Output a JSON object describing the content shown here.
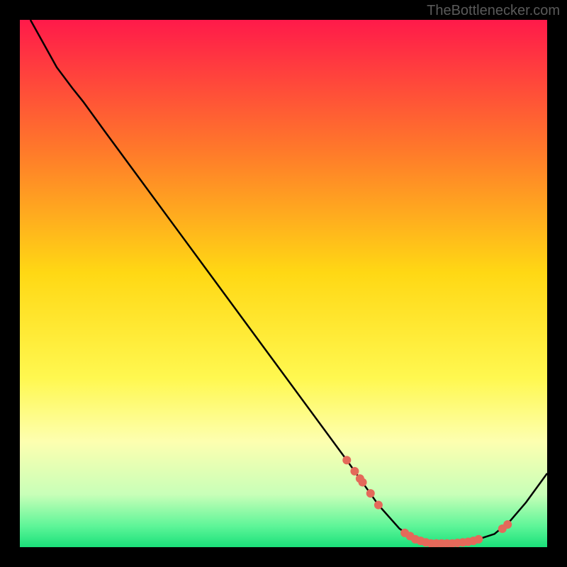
{
  "watermark": "TheBottlenecker.com",
  "chart_data": {
    "type": "line",
    "title": "",
    "xlabel": "",
    "ylabel": "",
    "xlim": [
      0,
      100
    ],
    "ylim": [
      0,
      100
    ],
    "background_gradient": {
      "stops": [
        {
          "offset": 0,
          "color": "#ff1a4a"
        },
        {
          "offset": 25,
          "color": "#ff7a2a"
        },
        {
          "offset": 48,
          "color": "#ffd814"
        },
        {
          "offset": 68,
          "color": "#fff850"
        },
        {
          "offset": 80,
          "color": "#fdffb0"
        },
        {
          "offset": 90,
          "color": "#c8ffb8"
        },
        {
          "offset": 96,
          "color": "#5ef598"
        },
        {
          "offset": 100,
          "color": "#1ae07a"
        }
      ]
    },
    "series": [
      {
        "name": "curve",
        "color": "#000000",
        "points": [
          {
            "x": 2,
            "y": 100
          },
          {
            "x": 7,
            "y": 91
          },
          {
            "x": 10,
            "y": 87
          },
          {
            "x": 12,
            "y": 84.5
          },
          {
            "x": 16,
            "y": 79
          },
          {
            "x": 62,
            "y": 16.5
          },
          {
            "x": 68,
            "y": 8
          },
          {
            "x": 72,
            "y": 3.5
          },
          {
            "x": 75,
            "y": 1.5
          },
          {
            "x": 78,
            "y": 0.7
          },
          {
            "x": 82,
            "y": 0.7
          },
          {
            "x": 86,
            "y": 1.2
          },
          {
            "x": 90,
            "y": 2.5
          },
          {
            "x": 93,
            "y": 5
          },
          {
            "x": 96,
            "y": 8.5
          },
          {
            "x": 100,
            "y": 14
          }
        ]
      }
    ],
    "markers": {
      "color": "#e4695a",
      "radius": 6,
      "points": [
        {
          "x": 62,
          "y": 16.5
        },
        {
          "x": 63.5,
          "y": 14.4
        },
        {
          "x": 64.5,
          "y": 13.0
        },
        {
          "x": 65,
          "y": 12.3
        },
        {
          "x": 66.5,
          "y": 10.2
        },
        {
          "x": 68,
          "y": 8
        },
        {
          "x": 73,
          "y": 2.7
        },
        {
          "x": 74,
          "y": 2.1
        },
        {
          "x": 75,
          "y": 1.5
        },
        {
          "x": 76,
          "y": 1.2
        },
        {
          "x": 77,
          "y": 0.9
        },
        {
          "x": 78,
          "y": 0.7
        },
        {
          "x": 79,
          "y": 0.7
        },
        {
          "x": 80,
          "y": 0.7
        },
        {
          "x": 81,
          "y": 0.7
        },
        {
          "x": 82,
          "y": 0.7
        },
        {
          "x": 83,
          "y": 0.8
        },
        {
          "x": 84,
          "y": 0.9
        },
        {
          "x": 85,
          "y": 1.0
        },
        {
          "x": 86,
          "y": 1.2
        },
        {
          "x": 87,
          "y": 1.5
        },
        {
          "x": 91.5,
          "y": 3.5
        },
        {
          "x": 92.5,
          "y": 4.3
        }
      ]
    }
  }
}
